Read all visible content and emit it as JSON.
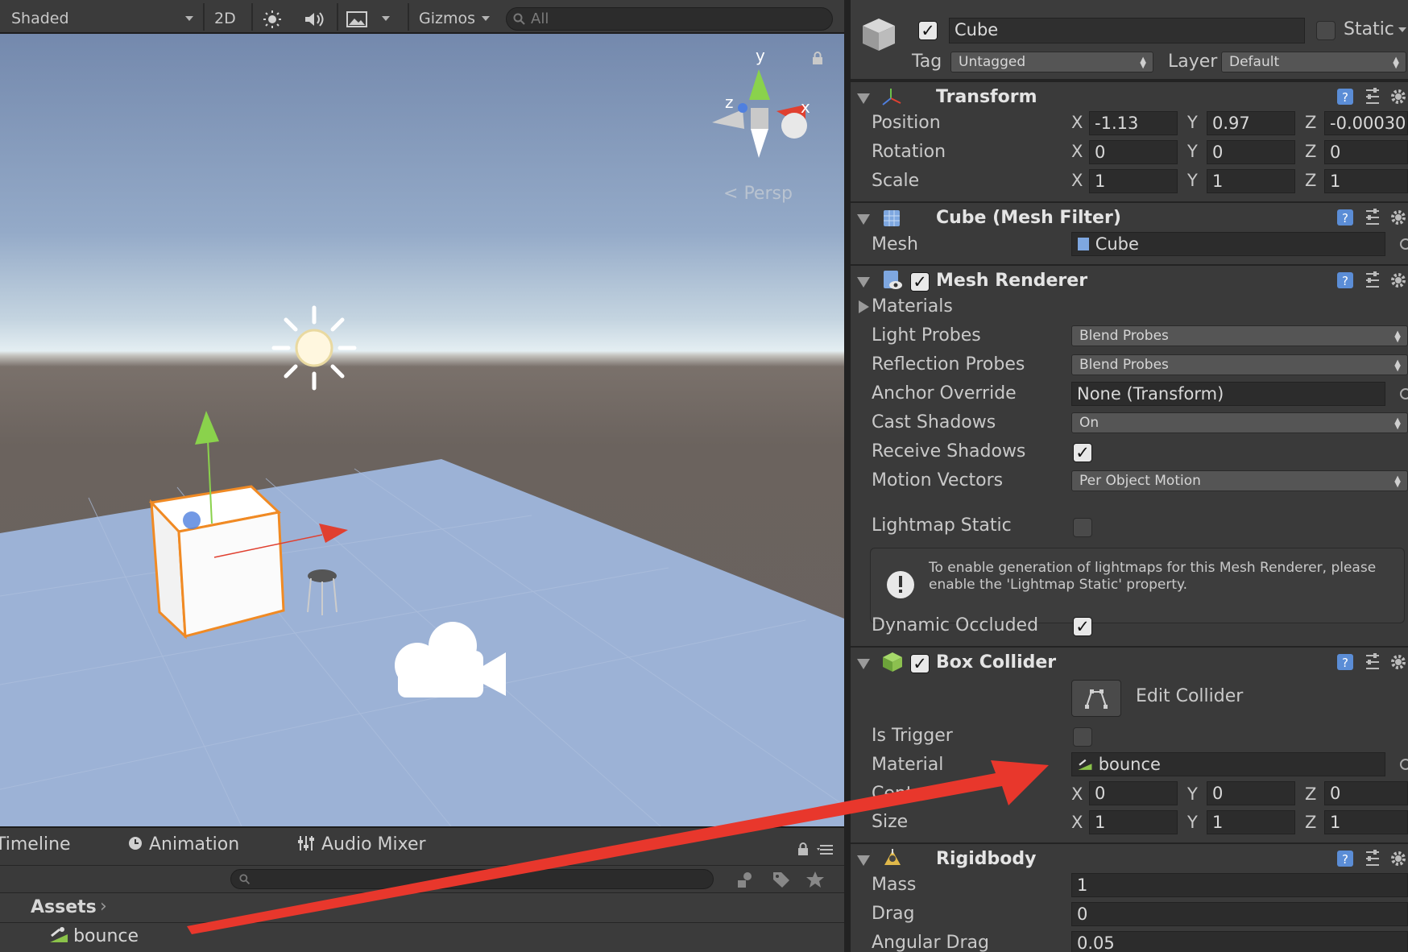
{
  "toolbar": {
    "shading_mode": "Shaded",
    "mode_2d": "2D",
    "gizmos": "Gizmos",
    "search_placeholder": "All"
  },
  "scene": {
    "projection": "Persp",
    "gizmo_axes": {
      "x": "x",
      "y": "y",
      "z": "z"
    }
  },
  "bottom_panel": {
    "tabs": [
      "Timeline",
      "Animation",
      "Audio Mixer"
    ],
    "breadcrumb": "Assets",
    "assets": [
      {
        "name": "bounce",
        "icon": "physic-material-icon"
      }
    ]
  },
  "inspector": {
    "object_name": "Cube",
    "active": true,
    "static_label": "Static",
    "static": false,
    "tag_label": "Tag",
    "tag": "Untagged",
    "layer_label": "Layer",
    "layer": "Default",
    "transform": {
      "title": "Transform",
      "position_label": "Position",
      "rotation_label": "Rotation",
      "scale_label": "Scale",
      "position": {
        "x": "-1.13",
        "y": "0.97",
        "z": "-0.00030"
      },
      "rotation": {
        "x": "0",
        "y": "0",
        "z": "0"
      },
      "scale": {
        "x": "1",
        "y": "1",
        "z": "1"
      }
    },
    "mesh_filter": {
      "title": "Cube (Mesh Filter)",
      "mesh_label": "Mesh",
      "mesh": "Cube"
    },
    "mesh_renderer": {
      "title": "Mesh Renderer",
      "enabled": true,
      "materials_label": "Materials",
      "light_probes_label": "Light Probes",
      "light_probes": "Blend Probes",
      "reflection_probes_label": "Reflection Probes",
      "reflection_probes": "Blend Probes",
      "anchor_override_label": "Anchor Override",
      "anchor_override": "None (Transform)",
      "cast_shadows_label": "Cast Shadows",
      "cast_shadows": "On",
      "receive_shadows_label": "Receive Shadows",
      "receive_shadows": true,
      "motion_vectors_label": "Motion Vectors",
      "motion_vectors": "Per Object Motion",
      "lightmap_static_label": "Lightmap Static",
      "lightmap_static": false,
      "help_text": "To enable generation of lightmaps for this Mesh Renderer, please enable the 'Lightmap Static' property.",
      "dynamic_occluded_label": "Dynamic Occluded",
      "dynamic_occluded": true
    },
    "box_collider": {
      "title": "Box Collider",
      "enabled": true,
      "edit_collider_label": "Edit Collider",
      "is_trigger_label": "Is Trigger",
      "is_trigger": false,
      "material_label": "Material",
      "material": "bounce",
      "center_label": "Center",
      "center": {
        "x": "0",
        "y": "0",
        "z": "0"
      },
      "size_label": "Size",
      "size": {
        "x": "1",
        "y": "1",
        "z": "1"
      }
    },
    "rigidbody": {
      "title": "Rigidbody",
      "mass_label": "Mass",
      "mass": "1",
      "drag_label": "Drag",
      "drag": "0",
      "angular_drag_label": "Angular Drag",
      "angular_drag": "0.05"
    }
  },
  "colors": {
    "annotation_arrow": "#e8372c",
    "selection_outline": "#f08a24",
    "inspector_bg": "#3a3a3a"
  }
}
